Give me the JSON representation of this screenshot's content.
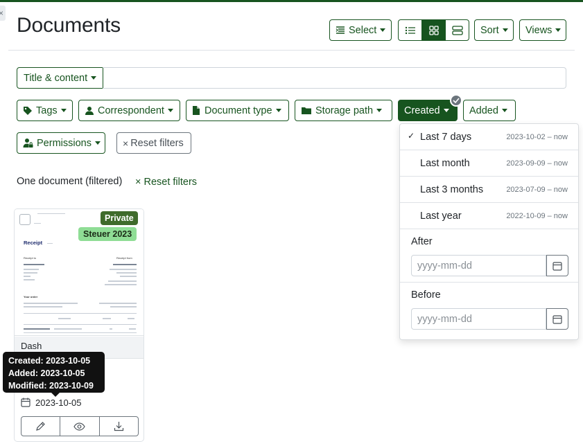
{
  "header": {
    "title": "Documents",
    "select_label": "Select",
    "sort_label": "Sort",
    "views_label": "Views"
  },
  "search": {
    "mode_label": "Title & content",
    "value": ""
  },
  "filters": {
    "tags": "Tags",
    "correspondent": "Correspondent",
    "document_type": "Document type",
    "storage_path": "Storage path",
    "created": "Created",
    "added": "Added",
    "permissions": "Permissions",
    "reset": "Reset filters"
  },
  "results": {
    "count_label": "One document (filtered)",
    "reset_label": "Reset filters"
  },
  "created_dropdown": {
    "options": [
      {
        "label": "Last 7 days",
        "range": "2023-10-02 – now",
        "selected": true
      },
      {
        "label": "Last month",
        "range": "2023-09-09 – now",
        "selected": false
      },
      {
        "label": "Last 3 months",
        "range": "2023-07-09 – now",
        "selected": false
      },
      {
        "label": "Last year",
        "range": "2022-10-09 – now",
        "selected": false
      }
    ],
    "check_mark": "✓",
    "after_label": "After",
    "before_label": "Before",
    "date_placeholder": "yyyy-mm-dd"
  },
  "card": {
    "title": "Dash",
    "tags": [
      "Private",
      "Steuer 2023"
    ],
    "date": "2023-10-05",
    "thumbnail": {
      "heading": "Receipt",
      "receipt_to": "Receipt to",
      "receipt_from": "Receipt from",
      "your_order": "Your order"
    }
  },
  "tooltip": {
    "created": "Created: 2023-10-05",
    "added": "Added: 2023-10-05",
    "modified": "Modified: 2023-10-09"
  },
  "colors": {
    "primary": "#17541f",
    "tag_private": "#3f6b2b",
    "tag_steuer": "#8fdd95"
  }
}
